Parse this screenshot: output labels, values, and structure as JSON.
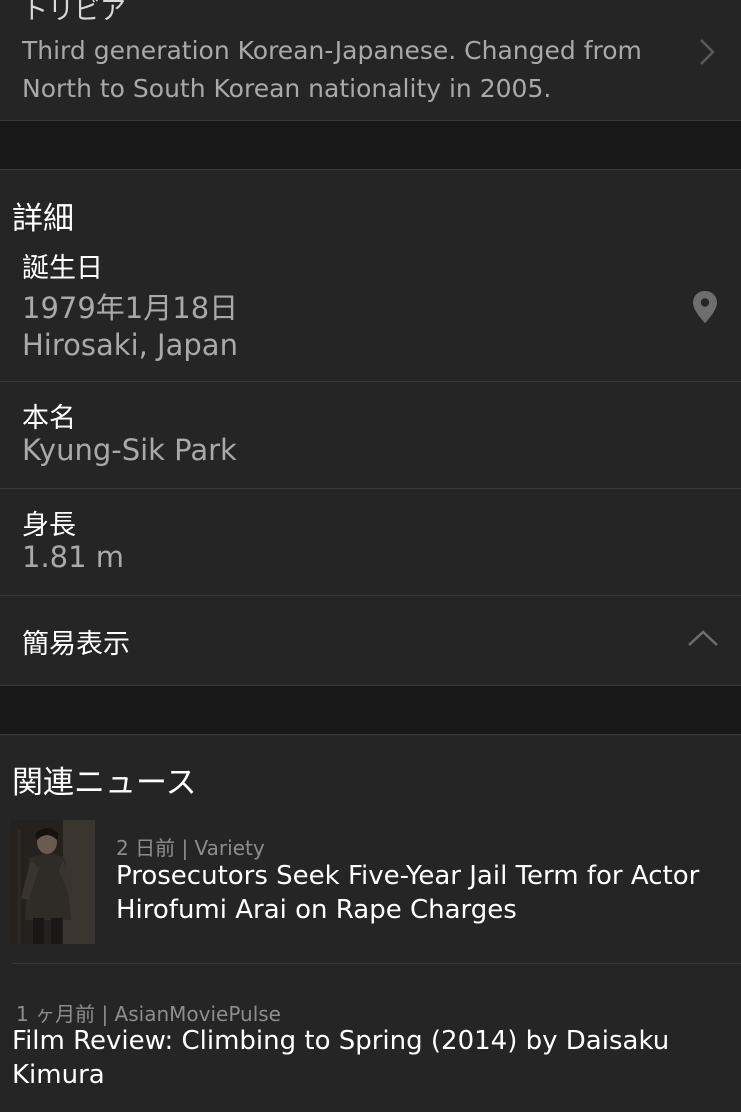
{
  "trivia": {
    "heading": "トリビア",
    "text": "Third generation Korean-Japanese. Changed from North to South Korean nationality in 2005.",
    "chevron_icon": "chevron-right-icon"
  },
  "details": {
    "title": "詳細",
    "birth": {
      "label": "誕生日",
      "date": "1979年1月18日",
      "place": "Hirosaki, Japan",
      "icon": "map-pin-icon"
    },
    "real_name": {
      "label": "本名",
      "value": "Kyung-Sik Park"
    },
    "height": {
      "label": "身長",
      "value": "1.81 m"
    },
    "toggle": {
      "label": "簡易表示",
      "icon": "chevron-up-icon"
    }
  },
  "news": {
    "title": "関連ニュース",
    "items": [
      {
        "meta": "2 日前 | Variety",
        "headline": "Prosecutors Seek Five-Year Jail Term for Actor Hirofumi Arai on Rape Charges",
        "has_thumbnail": true
      },
      {
        "meta": "1 ヶ月前 | AsianMoviePulse",
        "headline": "Film Review: Climbing to Spring (2014) by Daisaku Kimura",
        "has_thumbnail": false
      }
    ]
  },
  "colors": {
    "background": "#252525",
    "band": "#181818",
    "divider": "#3a3a3a",
    "secondary_text": "#a9a9a9",
    "meta_text": "#8d8d8d"
  }
}
